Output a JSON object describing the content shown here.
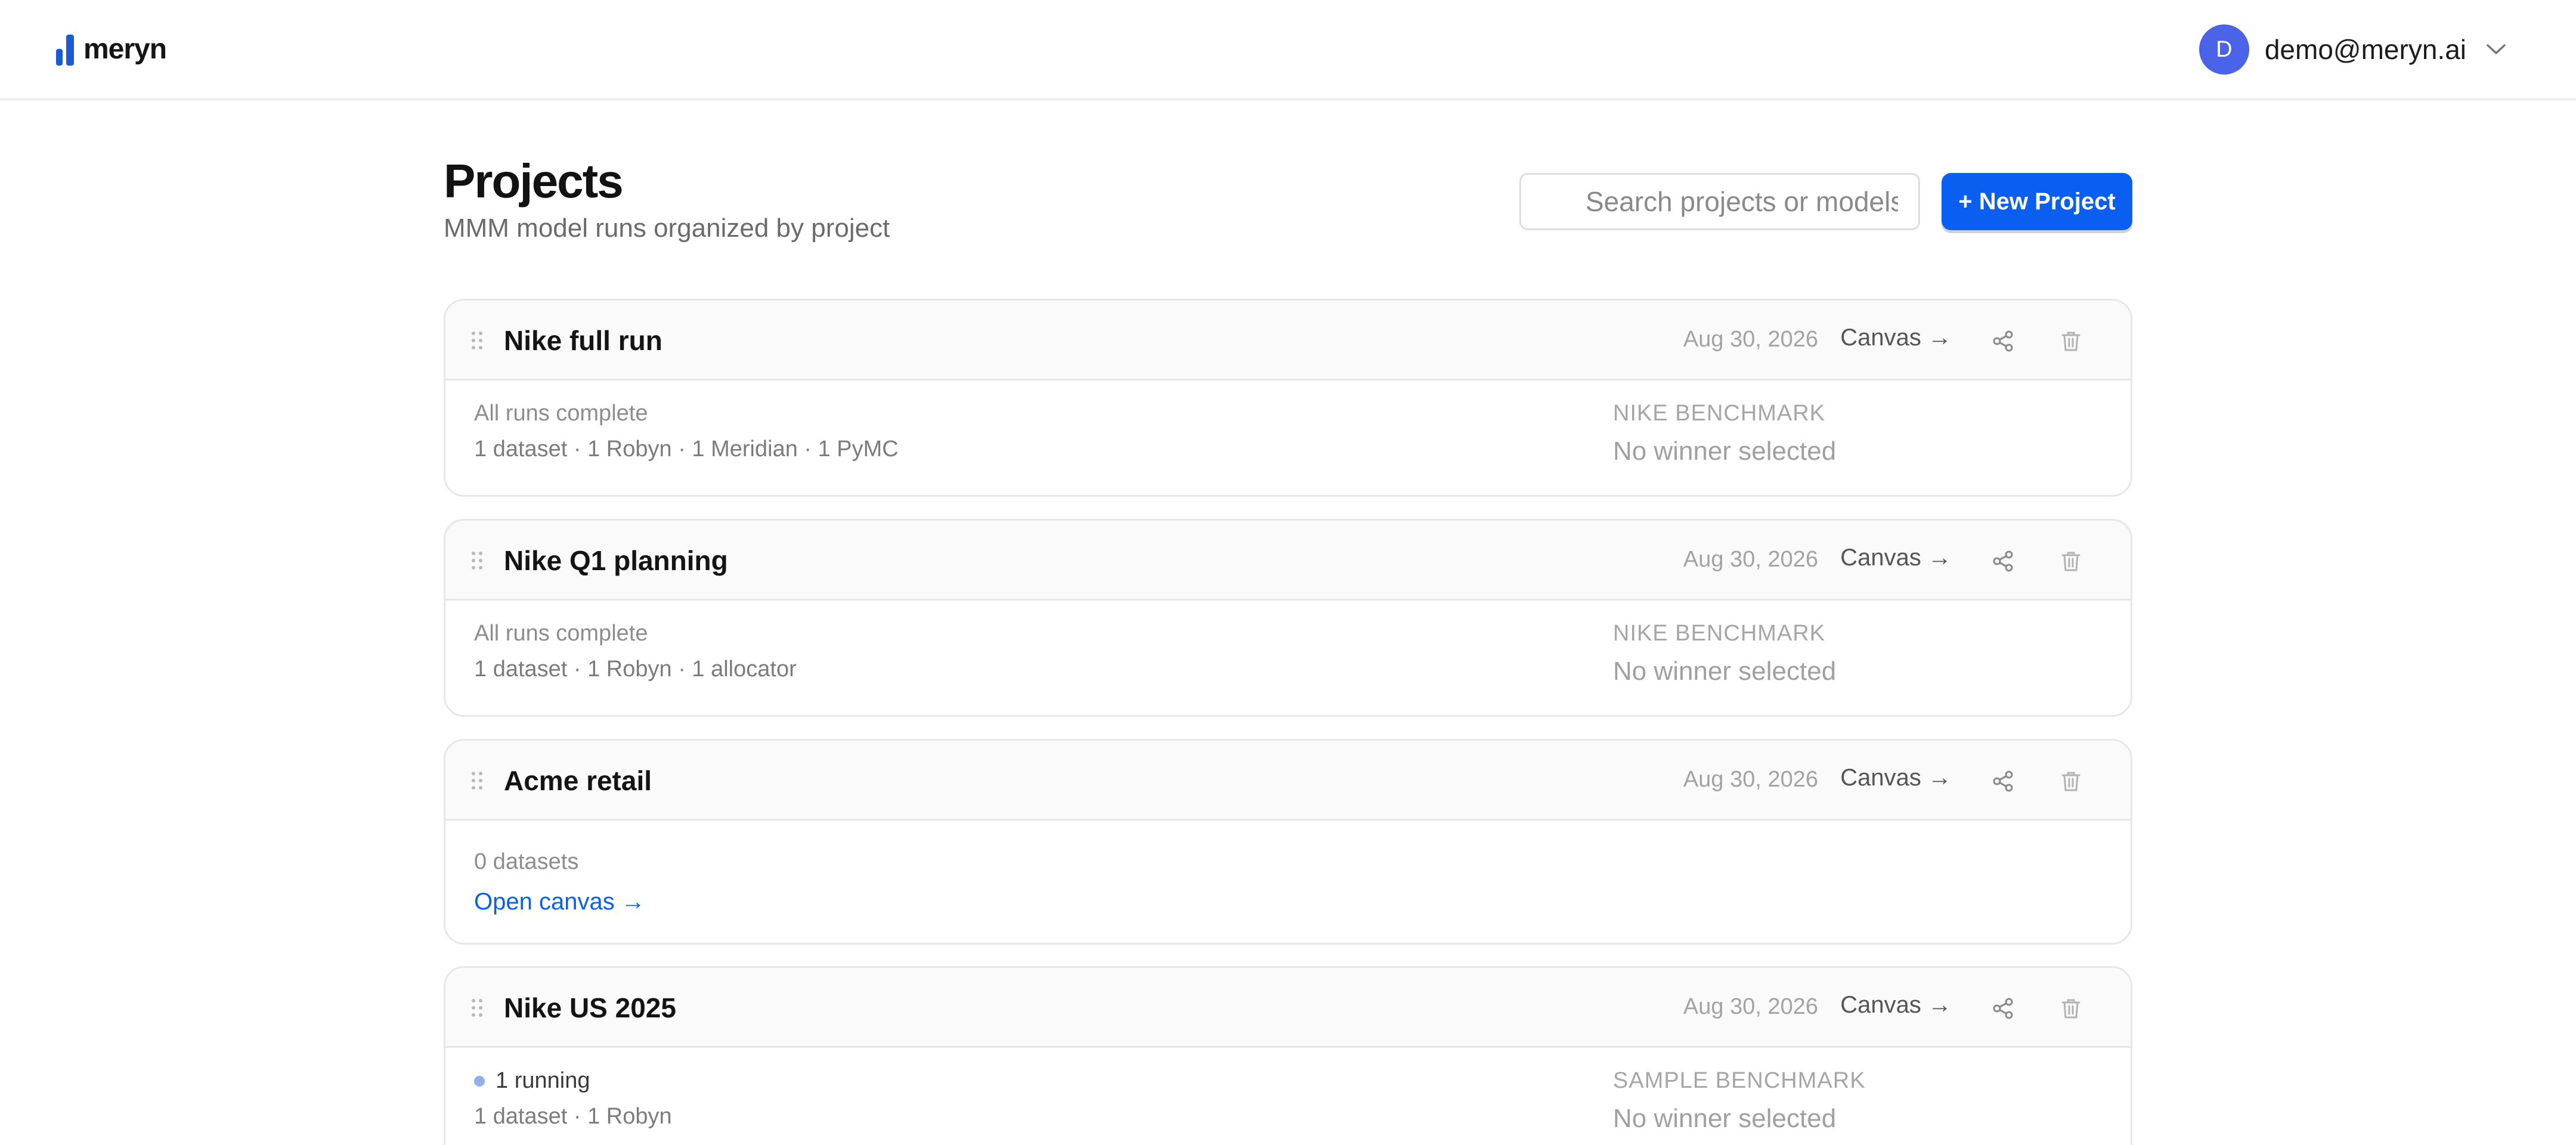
{
  "app": {
    "brand": "meryn",
    "brand_color": "#1a5ad8",
    "accent_color": "#0a5ff0"
  },
  "user": {
    "initial": "D",
    "email": "demo@meryn.ai",
    "menu_icon": "chevron-down-icon"
  },
  "page": {
    "title": "Projects",
    "subtitle": "MMM model runs organized by project",
    "search_placeholder": "Search projects or models...",
    "search_value": "",
    "new_project_label": "+ New Project"
  },
  "projects": [
    {
      "name": "Nike full run",
      "date": "Aug 30, 2026",
      "canvas_label": "Canvas →",
      "status": "All runs complete",
      "running": false,
      "meta": "1 dataset · 1 Robyn · 1 Meridian · 1 PyMC",
      "benchmark": "NIKE BENCHMARK",
      "winner": "No winner selected"
    },
    {
      "name": "Nike Q1 planning",
      "date": "Aug 30, 2026",
      "canvas_label": "Canvas →",
      "status": "All runs complete",
      "running": false,
      "meta": "1 dataset · 1 Robyn · 1 allocator",
      "benchmark": "NIKE BENCHMARK",
      "winner": "No winner selected"
    },
    {
      "name": "Acme retail",
      "date": "Aug 30, 2026",
      "canvas_label": "Canvas →",
      "status": "0 datasets",
      "running": false,
      "open_canvas_label": "Open canvas →"
    },
    {
      "name": "Nike US 2025",
      "date": "Aug 30, 2026",
      "canvas_label": "Canvas →",
      "status": "1 running",
      "running": true,
      "meta": "1 dataset · 1 Robyn",
      "benchmark": "SAMPLE BENCHMARK",
      "winner": "No winner selected"
    }
  ],
  "icons": {
    "drag": "drag-handle-icon",
    "share": "share-icon",
    "delete": "trash-icon"
  }
}
